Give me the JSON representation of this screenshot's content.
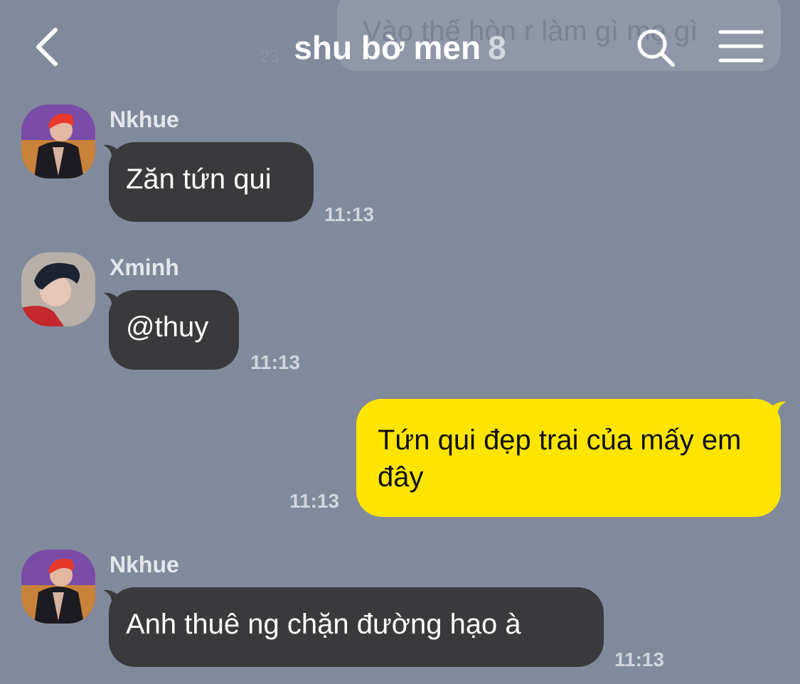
{
  "header": {
    "title": "shu bờ men",
    "member_count": "8",
    "back_icon": "chevron-left-icon",
    "search_icon": "search-icon",
    "menu_icon": "hamburger-menu-icon"
  },
  "previous_message": {
    "text": "Vào thế hòn r làm gì mẹ gì",
    "time_fragment": "23"
  },
  "messages": [
    {
      "sender": "Nkhue",
      "text": "Zăn tứn qui",
      "time": "11:13",
      "direction": "incoming"
    },
    {
      "sender": "Xminh",
      "text": "@thuy",
      "time": "11:13",
      "direction": "incoming"
    },
    {
      "sender": "",
      "text": "Tứn qui đẹp trai của mấy em đây",
      "time": "11:13",
      "direction": "outgoing"
    },
    {
      "sender": "Nkhue",
      "text": "Anh thuê ng chặn đường hạo à",
      "time": "11:13",
      "direction": "incoming"
    }
  ],
  "colors": {
    "background": "#818a9d",
    "incoming_bubble": "#3a3a3c",
    "outgoing_bubble": "#fee500"
  }
}
